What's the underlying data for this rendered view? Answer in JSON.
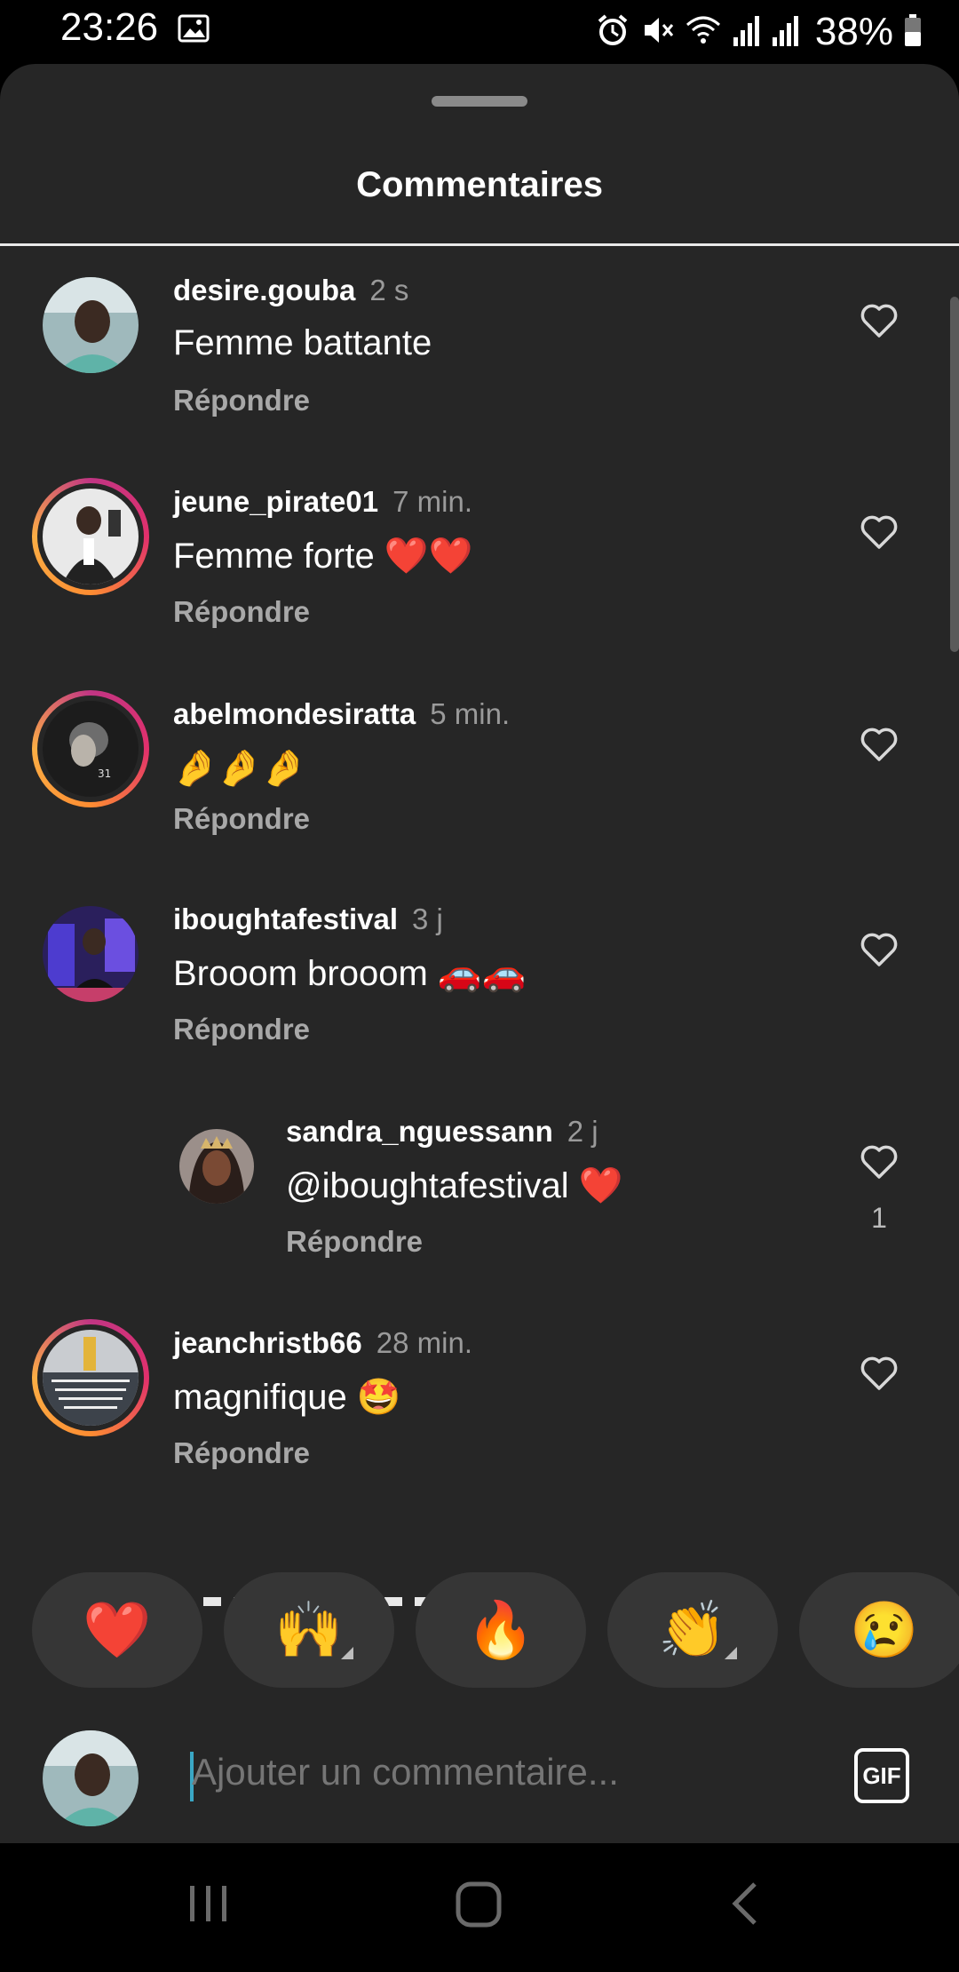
{
  "status_bar": {
    "time": "23:26",
    "battery": "38%",
    "icons": [
      "image-icon",
      "alarm-icon",
      "mute-icon",
      "wifi-icon",
      "signal-icon",
      "signal-icon",
      "battery-icon"
    ]
  },
  "sheet": {
    "title": "Commentaires"
  },
  "comments": [
    {
      "username": "desire.gouba",
      "time": "2 s",
      "text": "Femme battante",
      "reply": "Répondre"
    },
    {
      "username": "jeune_pirate01",
      "time": "7 min.",
      "text": "Femme forte ❤️❤️",
      "reply": "Répondre"
    },
    {
      "username": "abelmondesiratta",
      "time": "5 min.",
      "text": "🤌🤌🤌",
      "reply": "Répondre"
    },
    {
      "username": "iboughtafestival",
      "time": "3 j",
      "text": "Brooom brooom 🚗🚗",
      "reply": "Répondre"
    },
    {
      "username": "sandra_nguessann",
      "time": "2 j",
      "text": "@iboughtafestival ❤️",
      "reply": "Répondre",
      "likes": "1"
    },
    {
      "username": "jeanchristb66",
      "time": "28 min.",
      "text": "magnifique 🤩",
      "reply": "Répondre"
    }
  ],
  "reactions": [
    "❤️",
    "🙌",
    "🔥",
    "👏",
    "😢"
  ],
  "composer": {
    "placeholder": "Ajouter un commentaire...",
    "gif_label": "GIF"
  },
  "colors": {
    "sheet_bg": "#262626",
    "pill_bg": "#363636",
    "muted": "#a8a8a8"
  }
}
